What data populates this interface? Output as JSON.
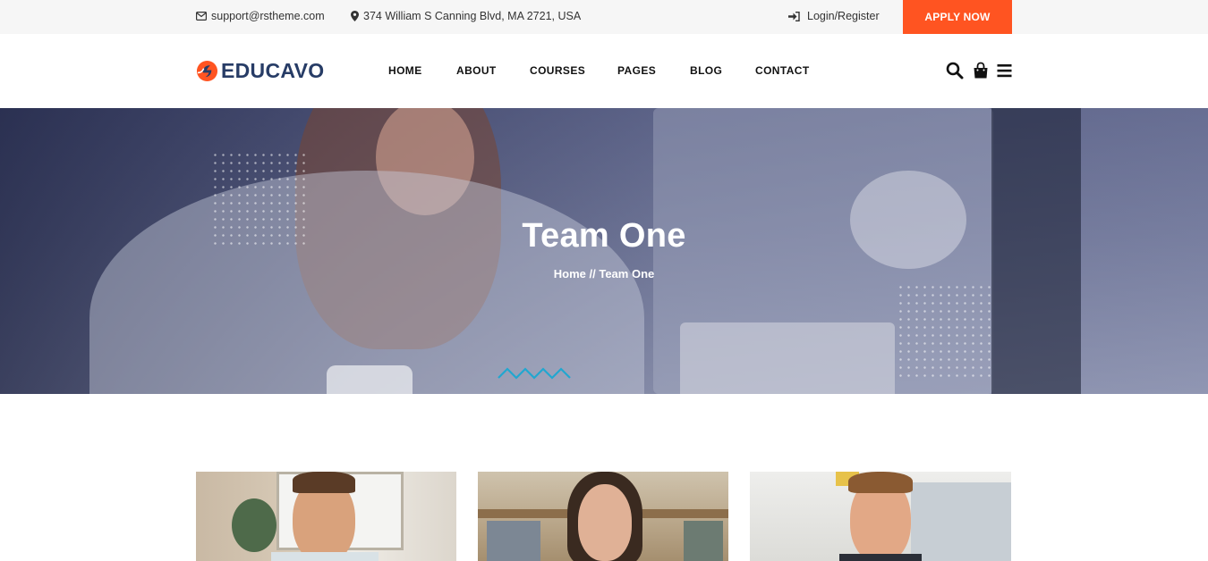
{
  "topbar": {
    "email": "support@rstheme.com",
    "address": "374 William S Canning Blvd, MA 2721, USA",
    "login": "Login/Register",
    "apply": "APPLY NOW"
  },
  "header": {
    "logo_text": "EDUCAVO",
    "nav": [
      "HOME",
      "ABOUT",
      "COURSES",
      "PAGES",
      "BLOG",
      "CONTACT"
    ]
  },
  "hero": {
    "title": "Team One",
    "breadcrumb_home": "Home",
    "breadcrumb_sep": " // ",
    "breadcrumb_current": "Team One"
  },
  "colors": {
    "accent": "#ff5421",
    "brand": "#273c66",
    "topbar_bg": "#f6f6f6"
  },
  "icons": [
    "envelope-icon",
    "map-marker-icon",
    "sign-in-icon",
    "search-icon",
    "shopping-bag-icon",
    "menu-icon"
  ]
}
